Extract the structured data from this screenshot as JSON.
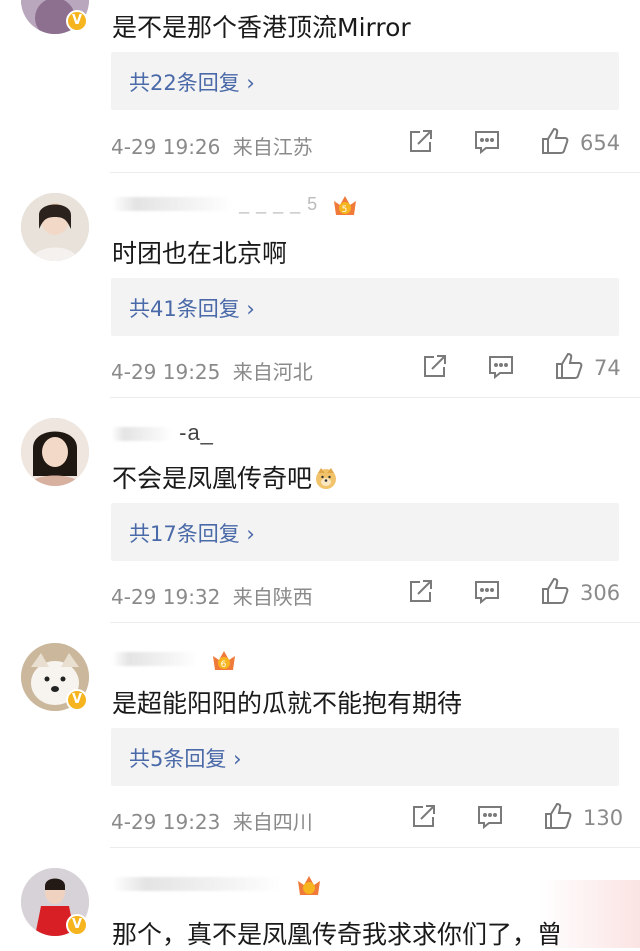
{
  "comments": [
    {
      "username_visible": "",
      "level": "",
      "text": "是不是那个香港顶流Mirror",
      "reply_label": "共22条回复",
      "time": "4-29 19:26",
      "location": "来自江苏",
      "likes": "654"
    },
    {
      "username_visible": "_ _ _ _ 5",
      "level": "5",
      "text": "时团也在北京啊",
      "reply_label": "共41条回复",
      "time": "4-29 19:25",
      "location": "来自河北",
      "likes": "74"
    },
    {
      "username_visible": "-a_",
      "level": "",
      "text": "不会是凤凰传奇吧",
      "reply_label": "共17条回复",
      "time": "4-29 19:32",
      "location": "来自陕西",
      "likes": "306"
    },
    {
      "username_visible": "",
      "level": "6",
      "text": "是超能阳阳的瓜就不能抱有期待",
      "reply_label": "共5条回复",
      "time": "4-29 19:23",
      "location": "来自四川",
      "likes": "130"
    },
    {
      "username_visible": "",
      "level": "",
      "text": "那个，真不是凤凰传奇我求求你们了，曾",
      "reply_label": "",
      "time": "",
      "location": "",
      "likes": ""
    }
  ],
  "colors": {
    "reply_link": "#4a69a8",
    "meta_gray": "#8a8a8a",
    "reply_bg": "#f3f3f3",
    "verified_badge": "#f6b51e",
    "level_crown": "#f07a3a"
  },
  "icons": {
    "repost": "repost-icon",
    "comment": "comment-icon",
    "like": "thumbs-up-icon",
    "reply_arrow": "chevron-right-icon"
  },
  "reply_arrow_glyph": "›"
}
